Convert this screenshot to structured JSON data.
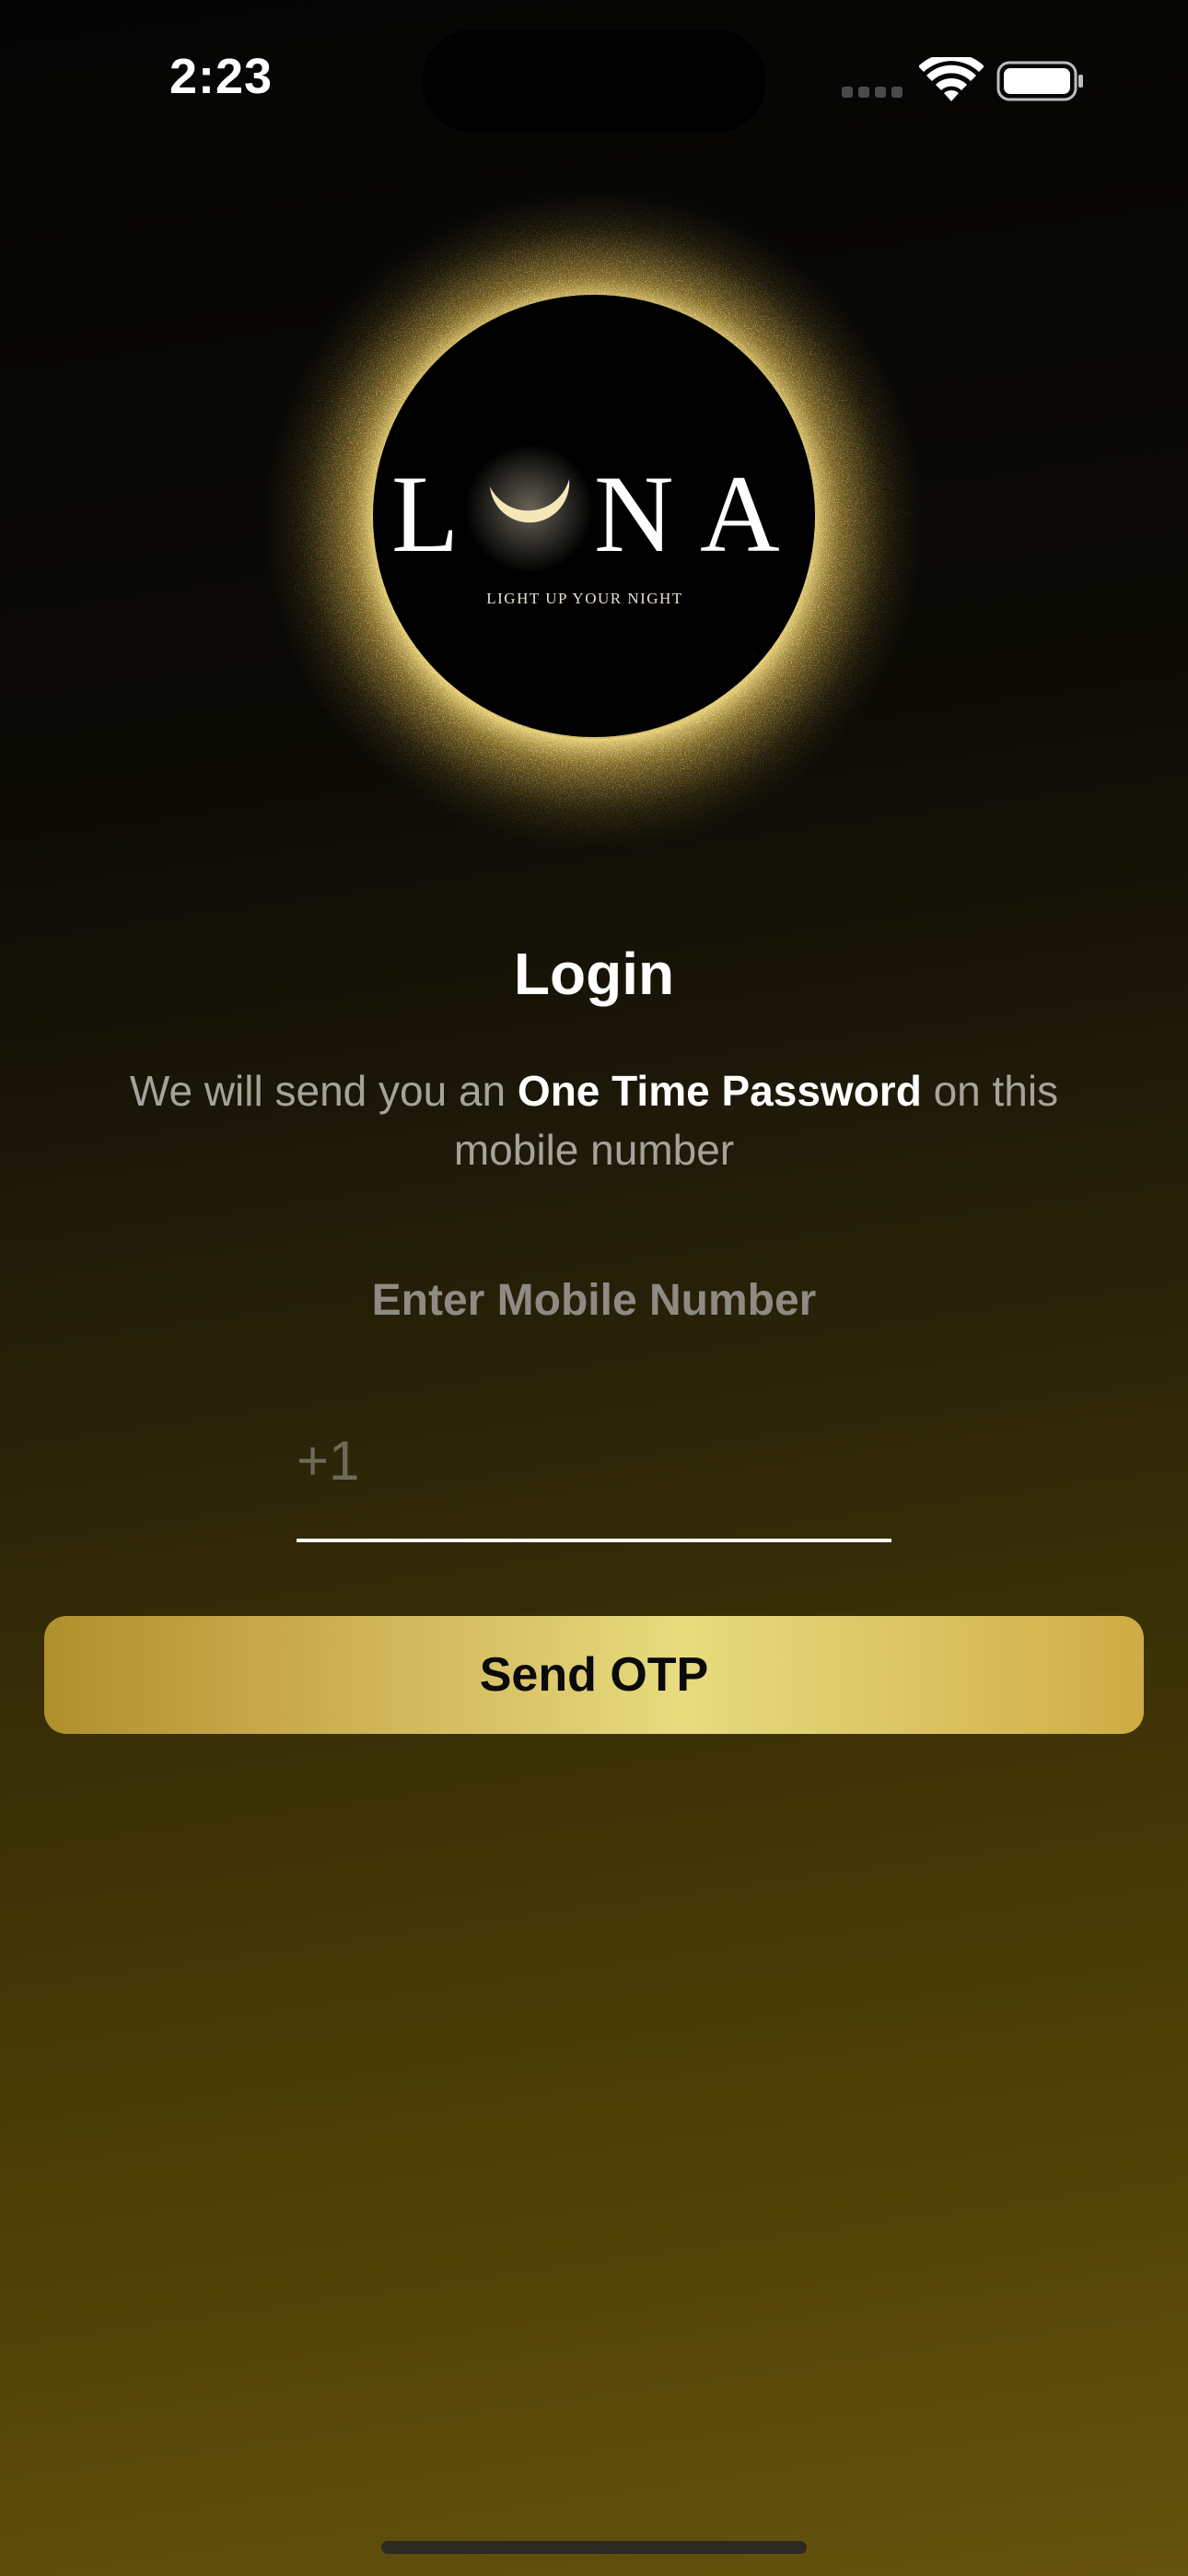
{
  "status_bar": {
    "time": "2:23"
  },
  "logo": {
    "wordmark": "LUNA",
    "tagline": "LIGHT UP YOUR NIGHT"
  },
  "login": {
    "title": "Login",
    "description_prefix": "We will send you an ",
    "description_bold": "One Time Password",
    "description_suffix": " on this mobile number",
    "field_label": "Enter Mobile Number",
    "phone_placeholder": "+1",
    "send_button": "Send OTP"
  },
  "colors": {
    "accent_gold": "#d9c061",
    "background_dark": "#050505",
    "background_olive": "#65530e"
  }
}
